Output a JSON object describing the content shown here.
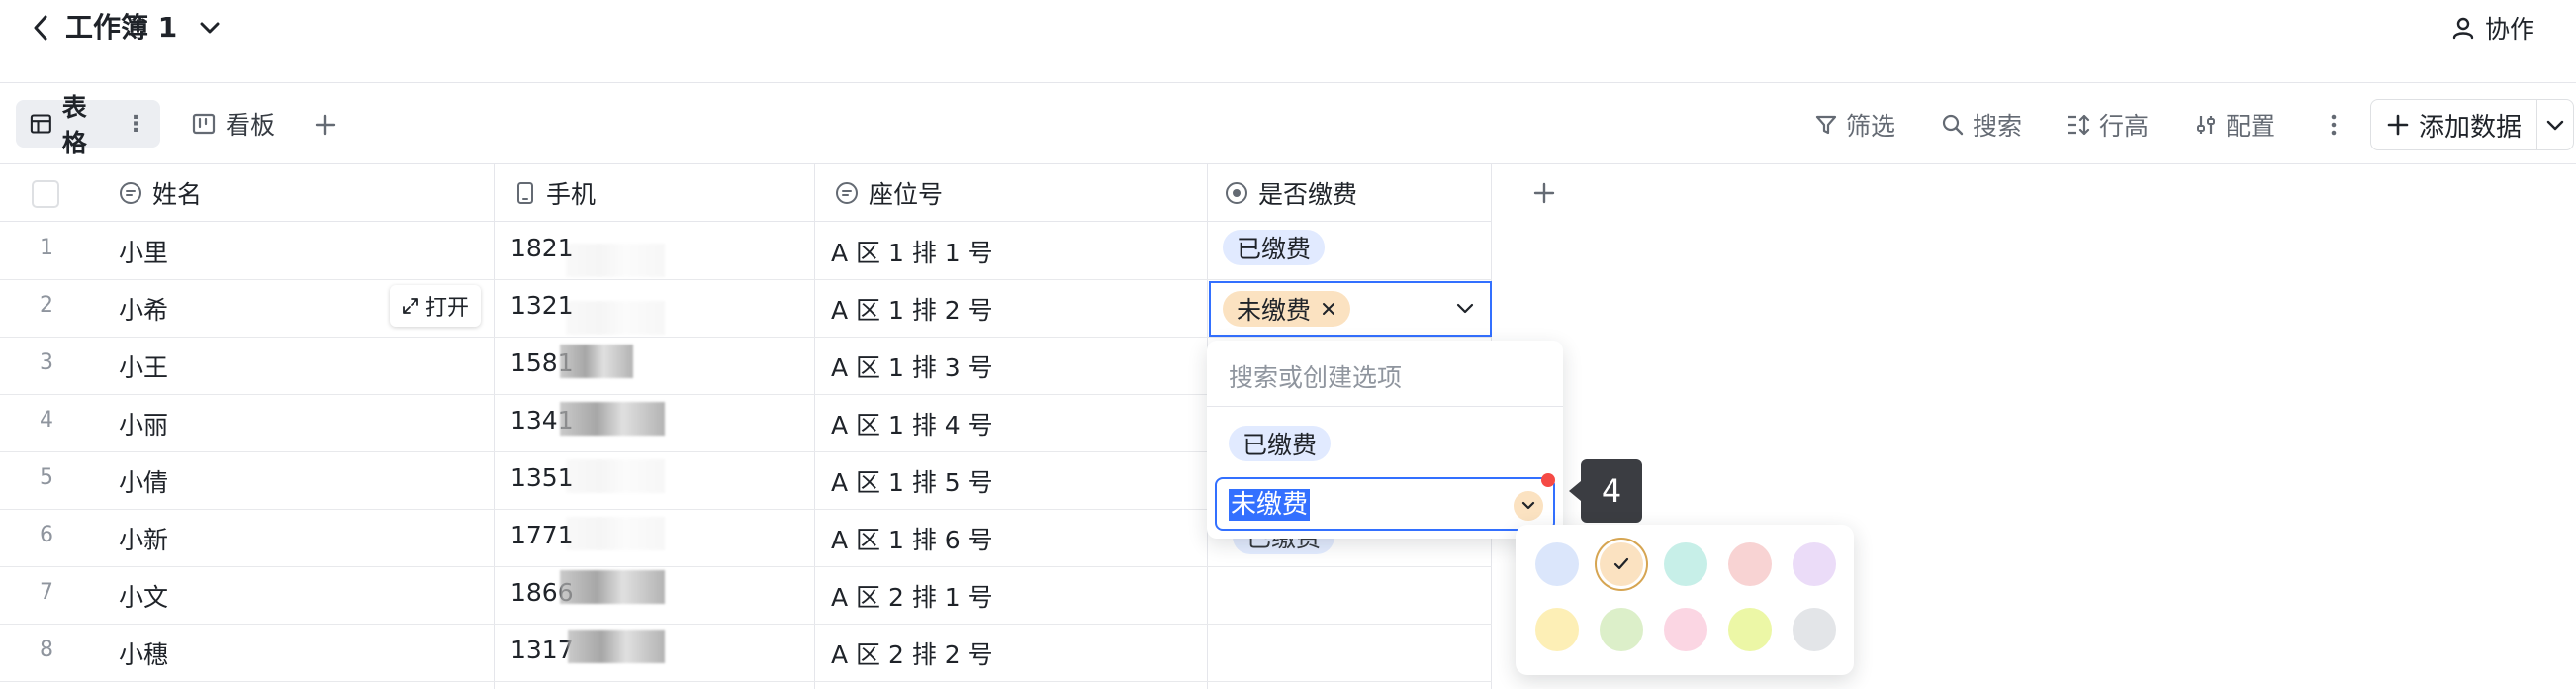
{
  "header": {
    "title": "工作簿 1",
    "collab_label": "协作"
  },
  "views": {
    "table_label": "表格",
    "board_label": "看板"
  },
  "toolbar": {
    "filter": "筛选",
    "search": "搜索",
    "row_height": "行高",
    "config": "配置",
    "add_data": "添加数据"
  },
  "columns": {
    "name": "姓名",
    "phone": "手机",
    "seat": "座位号",
    "paid": "是否缴费"
  },
  "rows": [
    {
      "num": "1",
      "name": "小里",
      "phone": "1821",
      "seat": "A 区 1 排 1 号",
      "paid": "已缴费"
    },
    {
      "num": "2",
      "name": "小希",
      "phone": "1321",
      "seat": "A 区 1 排 2 号",
      "paid": "未缴费"
    },
    {
      "num": "3",
      "name": "小王",
      "phone": "1581",
      "seat": "A 区 1 排 3 号",
      "paid": ""
    },
    {
      "num": "4",
      "name": "小丽",
      "phone": "1341",
      "seat": "A 区 1 排 4 号",
      "paid": ""
    },
    {
      "num": "5",
      "name": "小倩",
      "phone": "1351",
      "seat": "A 区 1 排 5 号",
      "paid": ""
    },
    {
      "num": "6",
      "name": "小新",
      "phone": "1771",
      "seat": "A 区 1 排 6 号",
      "paid": ""
    },
    {
      "num": "7",
      "name": "小文",
      "phone": "1866",
      "seat": "A 区 2 排 1 号",
      "paid": ""
    },
    {
      "num": "8",
      "name": "小穗",
      "phone": "1317",
      "seat": "A 区 2 排 2 号",
      "paid": ""
    }
  ],
  "row_hover": {
    "open_label": "打开"
  },
  "dropdown": {
    "search_placeholder": "搜索或创建选项",
    "option_paid": "已缴费",
    "editing_value": "未缴费",
    "behind_label": "已缴费"
  },
  "tooltip": {
    "text": "4"
  },
  "palette": {
    "colors": [
      "#dbe6fb",
      "#fbe2c1",
      "#c7efe8",
      "#f8d3d3",
      "#ebdcf8",
      "#fdefb6",
      "#dcefc9",
      "#fbd6e3",
      "#ecf7a6",
      "#e3e5e8"
    ],
    "selected": "#fbe2c1",
    "accent": "#3370ff"
  }
}
